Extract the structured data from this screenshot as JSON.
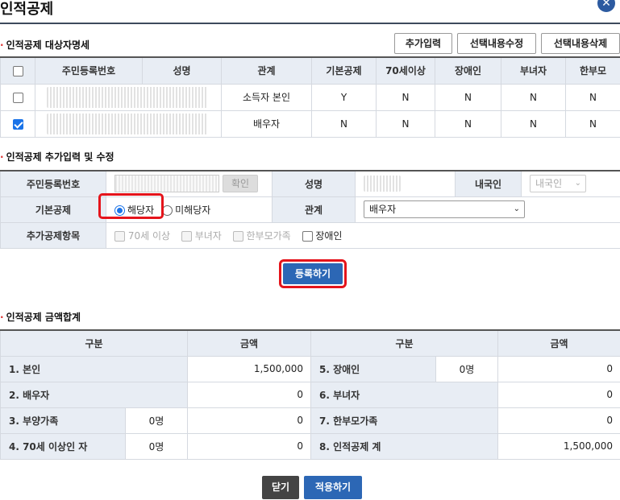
{
  "dialog": {
    "title": "인적공제",
    "close_symbol": "✕"
  },
  "section1": {
    "title": "인적공제 대상자명세",
    "buttons": [
      "추가입력",
      "선택내용수정",
      "선택내용삭제"
    ],
    "columns": [
      "주민등록번호",
      "성명",
      "관계",
      "기본공제",
      "70세이상",
      "장애인",
      "부녀자",
      "한부모"
    ],
    "rows": [
      {
        "checked": false,
        "relation": "소득자 본인",
        "basic": "Y",
        "over70": "N",
        "disabled": "N",
        "woman": "N",
        "single_parent": "N"
      },
      {
        "checked": true,
        "relation": "배우자",
        "basic": "N",
        "over70": "N",
        "disabled": "N",
        "woman": "N",
        "single_parent": "N"
      }
    ]
  },
  "section2": {
    "title": "인적공제 추가입력 및 수정",
    "labels": {
      "rrn": "주민등록번호",
      "name": "성명",
      "domestic": "내국인",
      "basic": "기본공제",
      "relation": "관계",
      "extra": "추가공제항목"
    },
    "confirm_label": "확인",
    "domestic_value": "내국인",
    "basic_options": [
      "해당자",
      "미해당자"
    ],
    "relation_value": "배우자",
    "extra_items": [
      "70세 이상",
      "부녀자",
      "한부모가족",
      "장애인"
    ],
    "register_label": "등록하기"
  },
  "section3": {
    "title": "인적공제 금액합계",
    "headers": [
      "구분",
      "금액",
      "구분",
      "금액"
    ],
    "left": [
      {
        "label": "1. 본인",
        "count": "",
        "amount": "1,500,000"
      },
      {
        "label": "2. 배우자",
        "count": "",
        "amount": "0"
      },
      {
        "label": "3. 부양가족",
        "count": "0명",
        "amount": "0"
      },
      {
        "label": "4. 70세 이상인 자",
        "count": "0명",
        "amount": "0"
      }
    ],
    "right": [
      {
        "label": "5. 장애인",
        "count": "0명",
        "amount": "0"
      },
      {
        "label": "6. 부녀자",
        "count": "",
        "amount": "0"
      },
      {
        "label": "7. 한부모가족",
        "count": "",
        "amount": "0"
      },
      {
        "label": "8. 인적공제 계",
        "count": "",
        "amount": "1,500,000"
      }
    ]
  },
  "footer": {
    "close_label": "닫기",
    "apply_label": "적용하기"
  },
  "colors": {
    "accent": "#2c67b5",
    "highlight": "#e5141b",
    "header_bg": "#e8edf4"
  }
}
